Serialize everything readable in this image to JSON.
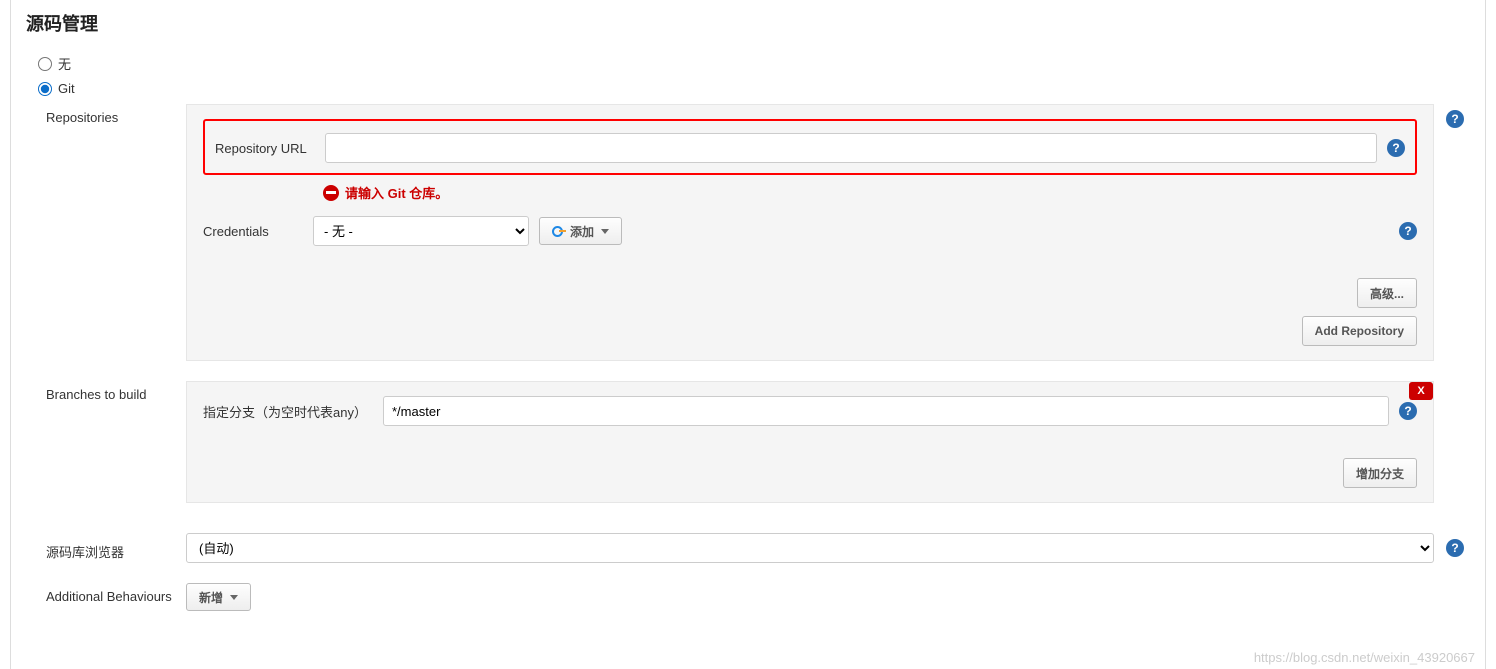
{
  "title": "源码管理",
  "scm_options": {
    "none": "无",
    "git": "Git"
  },
  "repositories": {
    "label": "Repositories",
    "repo_url_label": "Repository URL",
    "repo_url_value": "",
    "error_text": "请输入 Git 仓库。",
    "credentials_label": "Credentials",
    "credentials_selected": "- 无 -",
    "add_button": "添加",
    "advanced_button": "高级...",
    "add_repo_button": "Add Repository"
  },
  "branches": {
    "label": "Branches to build",
    "branch_spec_label": "指定分支（为空时代表any）",
    "branch_spec_value": "*/master",
    "add_branch_button": "增加分支",
    "delete_badge": "X"
  },
  "browser": {
    "label": "源码库浏览器",
    "selected": "(自动)"
  },
  "additional": {
    "label": "Additional Behaviours",
    "add_button": "新增"
  },
  "help": "?",
  "watermark": "https://blog.csdn.net/weixin_43920667"
}
